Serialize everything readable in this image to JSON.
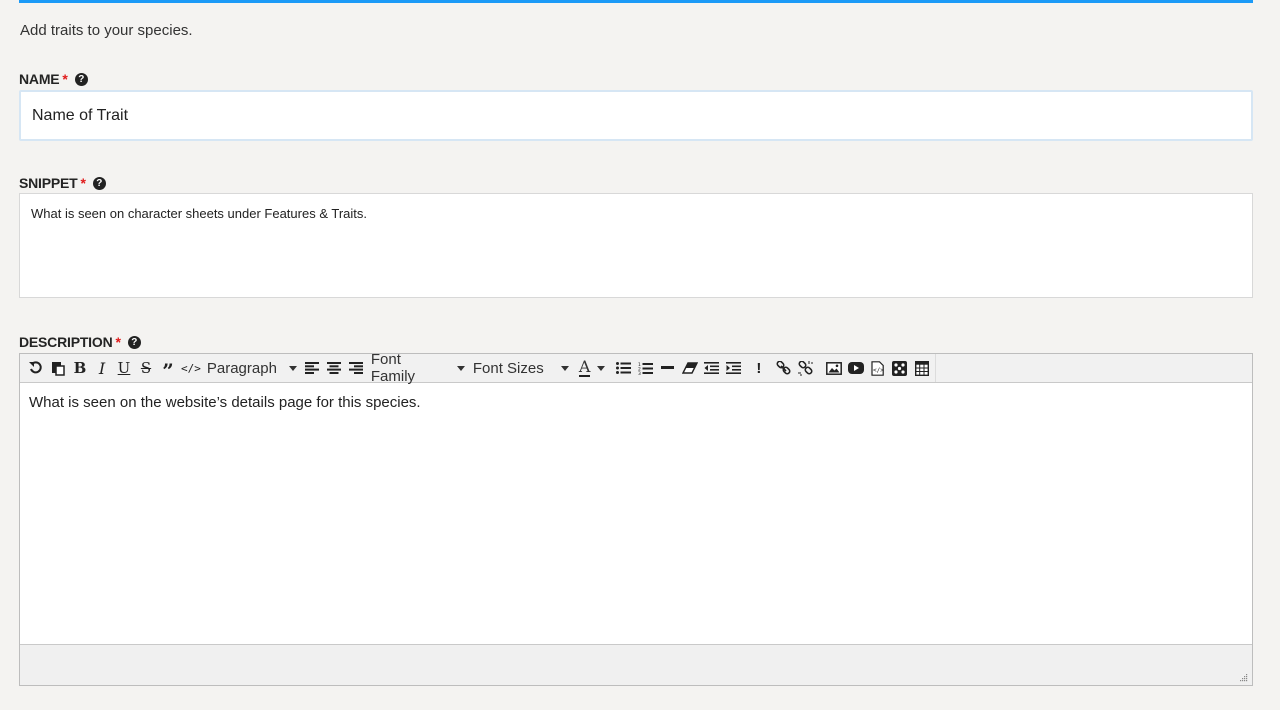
{
  "intro": "Add traits to your species.",
  "fields": {
    "name": {
      "label": "NAME",
      "required": "*",
      "help": "?",
      "value": "Name of Trait"
    },
    "snippet": {
      "label": "SNIPPET",
      "required": "*",
      "help": "?",
      "value": "What is seen on character sheets under Features & Traits."
    },
    "description": {
      "label": "DESCRIPTION",
      "required": "*",
      "help": "?",
      "value": "What is seen on the website’s details page for this species."
    }
  },
  "toolbar": {
    "bold": "B",
    "italic": "I",
    "underline": "U",
    "strike": "S",
    "blockquote": "”",
    "code": "</>",
    "format": "Paragraph",
    "font_family": "Font Family",
    "font_sizes": "Font Sizes",
    "text_color": "A",
    "special_char": "!"
  },
  "colors": {
    "accent": "#1b9af7",
    "required": "#e01b1b"
  }
}
